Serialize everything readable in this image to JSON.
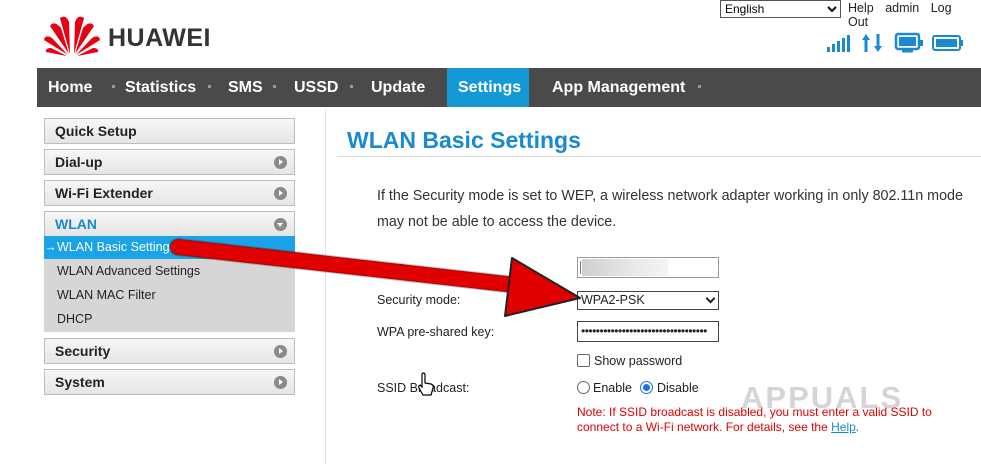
{
  "header": {
    "brand": "HUAWEI",
    "language": "English",
    "links": [
      "Help",
      "admin",
      "Log Out"
    ],
    "status_icons": [
      "signal-icon",
      "data-transfer-icon",
      "monitor-icon",
      "battery-icon"
    ]
  },
  "nav": {
    "items": [
      "Home",
      "Statistics",
      "SMS",
      "USSD",
      "Update",
      "Settings",
      "App Management"
    ],
    "active": "Settings"
  },
  "sidebar": {
    "quick_setup": "Quick Setup",
    "dialup": "Dial-up",
    "wifi_extender": "Wi-Fi Extender",
    "wlan": "WLAN",
    "wlan_items": [
      "WLAN Basic Settings",
      "WLAN Advanced Settings",
      "WLAN MAC Filter",
      "DHCP"
    ],
    "security": "Security",
    "system": "System"
  },
  "content": {
    "title": "WLAN Basic Settings",
    "description": "If the Security mode is set to WEP, a wireless network adapter working in only 802.11n mode may not be able to access the device.",
    "ssid_label": "SSID:",
    "security_label": "Security mode:",
    "security_value": "WPA2-PSK",
    "psk_label": "WPA pre-shared key:",
    "psk_value": "••••••••••••••••••••••••••••••••••",
    "show_password": "Show password",
    "broadcast_label": "SSID Broadcast:",
    "enable": "Enable",
    "disable": "Disable",
    "note": "Note: If SSID broadcast is disabled, you must enter a valid SSID to connect to a Wi-Fi network. For details, see the ",
    "help_link": "Help",
    "note_end": "."
  },
  "watermark": "APPUALS",
  "colors": {
    "accent": "#1598d6",
    "nav_bg": "#4a4a4a",
    "annotation": "#e00000",
    "note": "#e00000"
  }
}
